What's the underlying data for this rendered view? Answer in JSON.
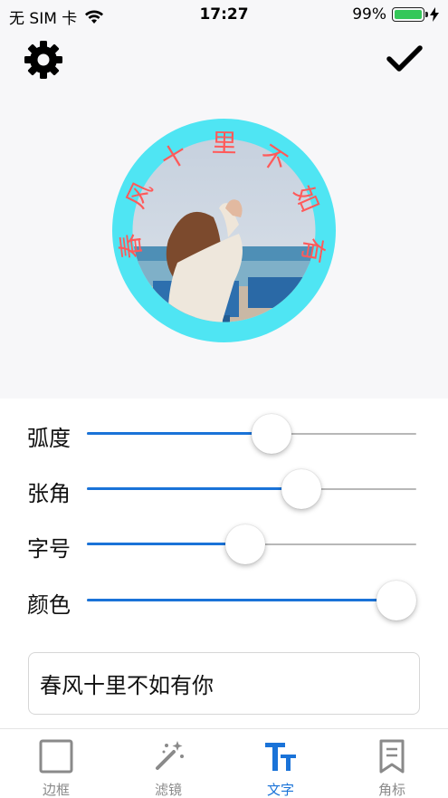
{
  "status_bar": {
    "carrier": "无 SIM 卡",
    "time": "17:27",
    "battery": "99%",
    "battery_level": 0.99,
    "icons": [
      "wifi-icon",
      "battery-icon",
      "charging-icon"
    ]
  },
  "nav": {
    "left_icon": "gear-icon",
    "right_icon": "checkmark-icon"
  },
  "preview": {
    "curved_text": "春风十里不如有你",
    "ring_color": "#4fe5f3",
    "text_color": "#ff5a5a"
  },
  "controls": {
    "sliders": [
      {
        "label": "弧度",
        "value": 0.56
      },
      {
        "label": "张角",
        "value": 0.65
      },
      {
        "label": "字号",
        "value": 0.48
      },
      {
        "label": "颜色",
        "value": 0.94
      }
    ],
    "accent_color": "#1a73d8",
    "text_input": {
      "value": "春风十里不如有你",
      "placeholder": ""
    }
  },
  "tab_bar": {
    "active_index": 2,
    "tabs": [
      {
        "label": "边框",
        "icon": "border-square-icon"
      },
      {
        "label": "滤镜",
        "icon": "magic-wand-icon"
      },
      {
        "label": "文字",
        "icon": "text-size-icon"
      },
      {
        "label": "角标",
        "icon": "badge-bookmark-icon"
      }
    ]
  }
}
